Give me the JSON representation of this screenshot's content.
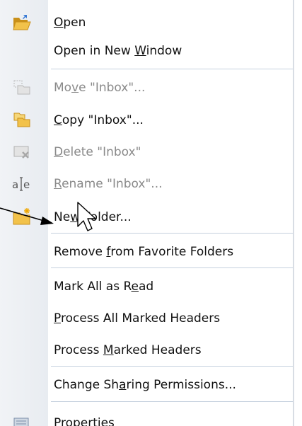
{
  "menu": {
    "items": [
      {
        "pre": "",
        "acc": "O",
        "post": "pen",
        "disabled": false,
        "icon": "open-folder-icon"
      },
      {
        "pre": "Open in New ",
        "acc": "W",
        "post": "indow",
        "disabled": false,
        "icon": ""
      },
      {
        "pre": "Mo",
        "acc": "v",
        "post": "e \"Inbox\"...",
        "disabled": true,
        "icon": "move-folder-icon"
      },
      {
        "pre": "",
        "acc": "C",
        "post": "opy \"Inbox\"...",
        "disabled": false,
        "icon": "copy-folder-icon"
      },
      {
        "pre": "",
        "acc": "D",
        "post": "elete \"Inbox\"",
        "disabled": true,
        "icon": "delete-folder-icon"
      },
      {
        "pre": "",
        "acc": "R",
        "post": "ename \"Inbox\"...",
        "disabled": true,
        "icon": "rename-icon"
      },
      {
        "pre": "Ne",
        "acc": "w",
        "post": " Folder...",
        "disabled": false,
        "icon": "new-folder-icon"
      },
      {
        "pre": "Remove ",
        "acc": "f",
        "post": "rom Favorite Folders",
        "disabled": false,
        "icon": ""
      },
      {
        "pre": "Mark All as R",
        "acc": "e",
        "post": "ad",
        "disabled": false,
        "icon": ""
      },
      {
        "pre": "",
        "acc": "P",
        "post": "rocess All Marked Headers",
        "disabled": false,
        "icon": ""
      },
      {
        "pre": "Process ",
        "acc": "M",
        "post": "arked Headers",
        "disabled": false,
        "icon": ""
      },
      {
        "pre": "Change Sh",
        "acc": "a",
        "post": "ring Permissions...",
        "disabled": false,
        "icon": ""
      },
      {
        "pre": "",
        "acc": "P",
        "post": "roperties",
        "disabled": false,
        "icon": "properties-icon"
      }
    ]
  },
  "colors": {
    "folder": "#f2c24a",
    "folder_dark": "#c9901a",
    "separator": "#c5d0de",
    "disabled_text": "#8a8a8a"
  }
}
